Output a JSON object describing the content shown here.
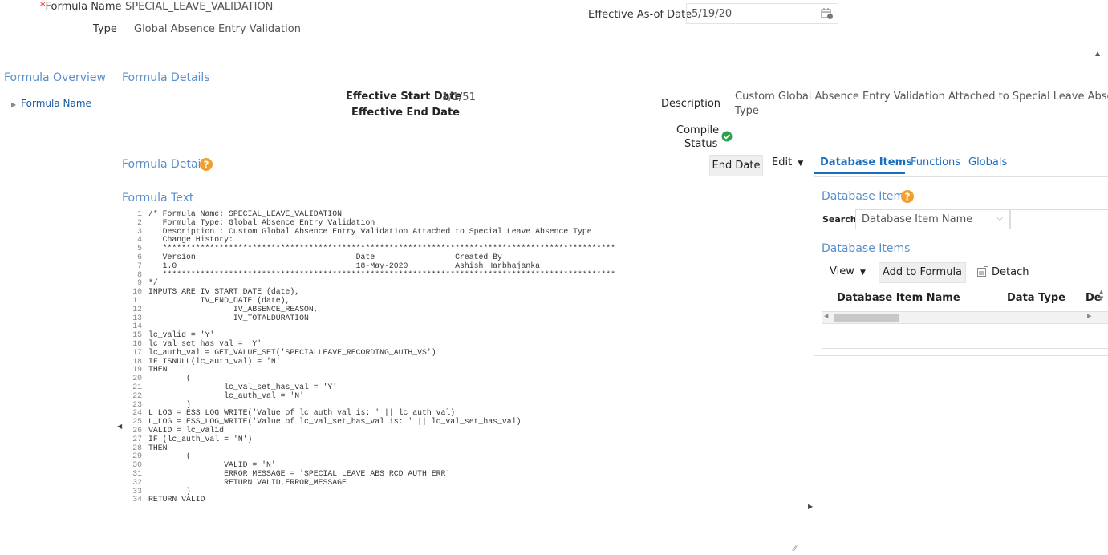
{
  "header": {
    "formula_name_label": "*Formula Name",
    "formula_name_req": "*",
    "formula_name_label_text": "Formula Name",
    "formula_name_value": "SPECIAL_LEAVE_VALIDATION",
    "type_label": "Type",
    "type_value": "Global Absence Entry Validation",
    "effective_label": "Effective As-of Date",
    "effective_value": "5/19/20",
    "calendar_icon": "calendar-icon"
  },
  "nav": {
    "overview_title": "Formula Overview",
    "items": [
      {
        "label": "Formula Name",
        "icon": "triangle-right-icon"
      }
    ]
  },
  "details": {
    "title": "Formula Details",
    "start_label": "Effective Start Date",
    "start_value": "1/1/51",
    "end_label": "Effective End Date",
    "description_label": "Description",
    "description_value_line1": "Custom Global Absence Entry Validation Attached to Special Leave Absence",
    "description_value_line2": "Type",
    "compile_label_1": "Compile",
    "compile_label_2": "Status",
    "compile_status": "success"
  },
  "formula_details": {
    "title": "Formula Details",
    "help_icon": "help-icon",
    "end_date_button": "End Date",
    "edit_menu": "Edit",
    "text_title": "Formula Text"
  },
  "code_lines": [
    "/* Formula Name: SPECIAL_LEAVE_VALIDATION",
    "   Formula Type: Global Absence Entry Validation",
    "   Description : Custom Global Absence Entry Validation Attached to Special Leave Absence Type",
    "   Change History:",
    "   ************************************************************************************************",
    "   Version                                  Date                 Created By",
    "   1.0                                      18-May-2020          Ashish Harbhajanka",
    "   ************************************************************************************************",
    "*/",
    "INPUTS ARE IV_START_DATE (date),",
    "           IV_END_DATE (date),",
    "                  IV_ABSENCE_REASON,",
    "                  IV_TOTALDURATION",
    "",
    "lc_valid = 'Y'",
    "lc_val_set_has_val = 'Y'",
    "lc_auth_val = GET_VALUE_SET('SPECIALLEAVE_RECORDING_AUTH_VS')",
    "IF ISNULL(lc_auth_val) = 'N'",
    "THEN",
    "        (",
    "                lc_val_set_has_val = 'Y'",
    "                lc_auth_val = 'N'",
    "        )",
    "L_LOG = ESS_LOG_WRITE('Value of lc_auth_val is: ' || lc_auth_val)",
    "L_LOG = ESS_LOG_WRITE('Value of lc_val_set_has_val is: ' || lc_val_set_has_val)",
    "VALID = lc_valid",
    "IF (lc_auth_val = 'N')",
    "THEN",
    "        (",
    "                VALID = 'N'",
    "                ERROR_MESSAGE = 'SPECIAL_LEAVE_ABS_RCD_AUTH_ERR'",
    "                RETURN VALID,ERROR_MESSAGE",
    "        )",
    "RETURN VALID"
  ],
  "right_panel": {
    "tabs": [
      "Database Items",
      "Functions",
      "Globals"
    ],
    "section_title": "Database Items",
    "search_label": "Search",
    "search_select": "Database Item Name",
    "results_title": "Database Items",
    "view_menu": "View",
    "add_button": "Add to Formula",
    "detach_button": "Detach",
    "columns": [
      "Database Item Name",
      "Data Type",
      "De"
    ]
  }
}
